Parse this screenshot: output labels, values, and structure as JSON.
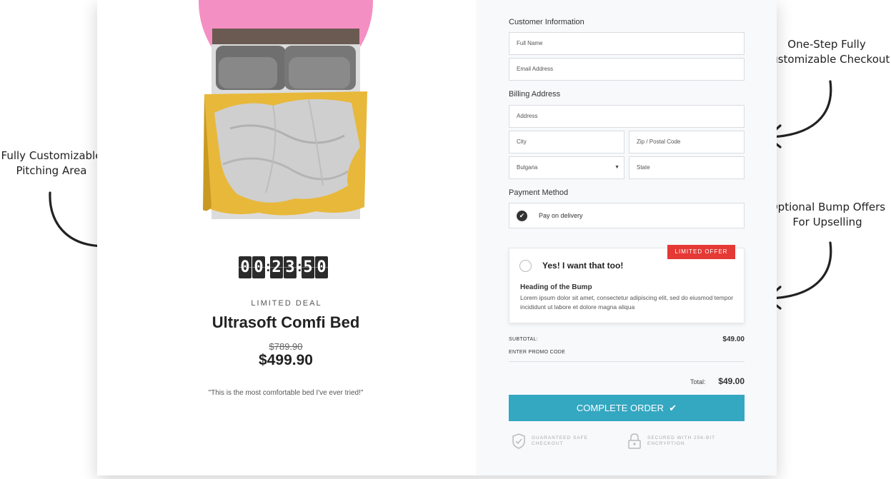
{
  "annotations": {
    "left_line1": "Fully Customizable",
    "left_line2": "Pitching Area",
    "right1_line1": "One-Step Fully",
    "right1_line2": "Customizable Checkout",
    "right2_line1": "Optional Bump Offers",
    "right2_line2": "For Upselling"
  },
  "product": {
    "timer_digits": [
      "0",
      "0",
      "2",
      "3",
      "5",
      "0"
    ],
    "timer_separator": ":",
    "deal_label": "LIMITED DEAL",
    "title": "Ultrasoft Comfi Bed",
    "old_price": "$789.90",
    "new_price": "$499.90",
    "quote": "\"This is the most comfortable bed I've ever tried!\""
  },
  "form": {
    "customer_title": "Customer Information",
    "full_name_placeholder": "Full Name",
    "email_placeholder": "Email Address",
    "billing_title": "Billing Address",
    "address_placeholder": "Address",
    "city_placeholder": "City",
    "zip_placeholder": "Zip / Postal Code",
    "country_value": "Bulgaria",
    "state_placeholder": "State",
    "payment_title": "Payment Method",
    "payment_option": "Pay on delivery"
  },
  "bump": {
    "badge": "LIMITED OFFER",
    "title": "Yes! I want that too!",
    "heading": "Heading of the Bump",
    "description": "Lorem ipsum dolor sit amet, consectetur adipiscing elit, sed do eiusmod tempor incididunt ut labore et dolore magna aliqua"
  },
  "summary": {
    "subtotal_label": "SUBTOTAL:",
    "subtotal_value": "$49.00",
    "promo_label": "ENTER PROMO CODE",
    "total_label": "Total:",
    "total_value": "$49.00",
    "button_label": "COMPLETE ORDER",
    "trust1_line1": "GUARANTEED SAFE",
    "trust1_line2": "CHECKOUT",
    "trust2_line1": "SECURED WITH 256-BIT",
    "trust2_line2": "ENCRYPTION"
  },
  "colors": {
    "accent": "#34a7c1",
    "badge": "#e53935",
    "blob": "#f48fc4"
  }
}
